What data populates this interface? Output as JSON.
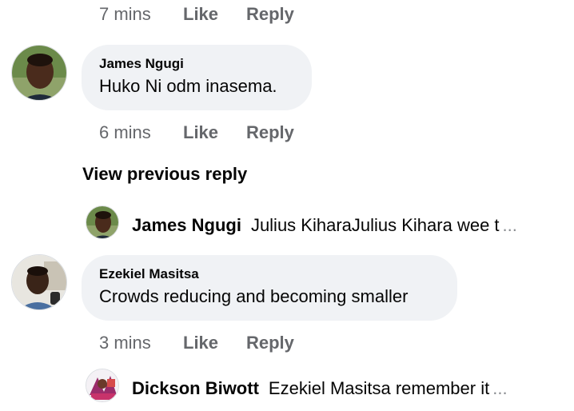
{
  "top_meta": {
    "time": "7 mins",
    "like": "Like",
    "reply": "Reply"
  },
  "comments": [
    {
      "author": "James Ngugi",
      "text": "Huko Ni odm inasema.",
      "time": "6 mins",
      "like": "Like",
      "reply": "Reply"
    },
    {
      "author": "Ezekiel Masitsa",
      "text": "Crowds reducing and becoming smaller",
      "time": "3 mins",
      "like": "Like",
      "reply": "Reply"
    }
  ],
  "view_previous_label": "View previous reply",
  "reply_previews": [
    {
      "author": "James Ngugi",
      "text": "Julius KiharaJulius Kihara wee t",
      "ellipsis": "..."
    },
    {
      "author": "Dickson Biwott",
      "text": "Ezekiel Masitsa remember it",
      "ellipsis": "..."
    }
  ],
  "colors": {
    "bubble_bg": "#f0f2f5",
    "meta_text": "#65676b",
    "text": "#050505"
  }
}
